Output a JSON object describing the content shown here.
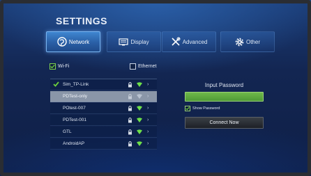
{
  "settings": {
    "title": "SETTINGS"
  },
  "tabs": [
    {
      "label": "Network",
      "icon": "globe-icon",
      "active": true
    },
    {
      "label": "Display",
      "icon": "display-icon",
      "active": false
    },
    {
      "label": "Advanced",
      "icon": "tools-icon",
      "active": false
    },
    {
      "label": "Other",
      "icon": "gear-icon",
      "active": false
    }
  ],
  "connection": {
    "wifi_label": "Wi-Fi",
    "wifi_checked": true,
    "ethernet_label": "Ethernet",
    "ethernet_checked": false
  },
  "networks": [
    {
      "name": "Sim_TP-Link",
      "connected": true,
      "selected": false
    },
    {
      "name": "PDTest-only",
      "connected": false,
      "selected": true
    },
    {
      "name": "POtest-007",
      "connected": false,
      "selected": false
    },
    {
      "name": "PDTest-001",
      "connected": false,
      "selected": false
    },
    {
      "name": "GTL",
      "connected": false,
      "selected": false
    },
    {
      "name": "AndroidAP",
      "connected": false,
      "selected": false
    }
  ],
  "password": {
    "label": "Input Password",
    "value": "",
    "show_label": "Show Password",
    "show_checked": true,
    "connect_label": "Connect Now"
  },
  "colors": {
    "accent": "#3f86d0",
    "input_green": "#6fb94a",
    "signal_green": "#6ee04a",
    "check_green": "#6ccf3c"
  }
}
